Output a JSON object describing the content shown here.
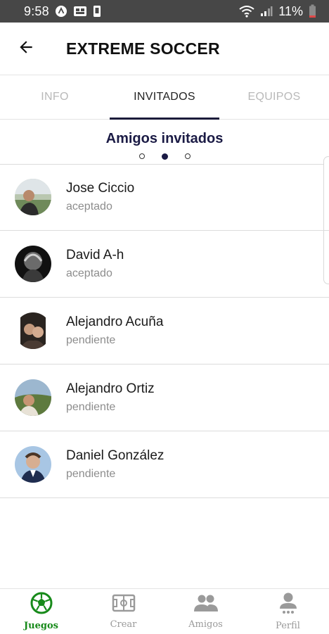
{
  "status_bar": {
    "time": "9:58",
    "battery": "11%",
    "icons": [
      "android-alert-icon",
      "sim-icon",
      "storage-icon",
      "wifi-icon",
      "signal-icon",
      "battery-low-icon"
    ]
  },
  "header": {
    "title": "EXTREME SOCCER",
    "back_icon": "arrow-left-icon"
  },
  "tabs": [
    {
      "label": "INFO",
      "active": false
    },
    {
      "label": "INVITADOS",
      "active": true
    },
    {
      "label": "EQUIPOS",
      "active": false
    }
  ],
  "section": {
    "title": "Amigos invitados",
    "page_count": 3,
    "current_page": 2
  },
  "invitees": [
    {
      "name": "Jose Ciccio",
      "status": "aceptado"
    },
    {
      "name": "David A-h",
      "status": "aceptado"
    },
    {
      "name": "Alejandro Acuña",
      "status": "pendiente"
    },
    {
      "name": "Alejandro Ortiz",
      "status": "pendiente"
    },
    {
      "name": "Daniel González",
      "status": "pendiente"
    }
  ],
  "bottom_nav": [
    {
      "label": "Juegos",
      "icon": "soccer-ball-icon",
      "active": true
    },
    {
      "label": "Crear",
      "icon": "field-icon",
      "active": false
    },
    {
      "label": "Amigos",
      "icon": "people-icon",
      "active": false
    },
    {
      "label": "Perfil",
      "icon": "person-icon",
      "active": false
    }
  ],
  "colors": {
    "status_bar": "#474747",
    "accent": "#1b1b45",
    "nav_active": "#178a1a",
    "muted": "#8d8d8d"
  }
}
